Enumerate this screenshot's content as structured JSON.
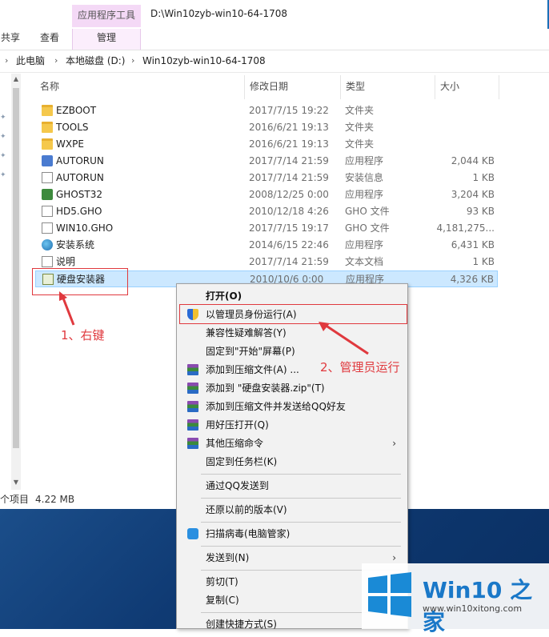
{
  "window": {
    "title": "D:\\Win10zyb-win10-64-1708",
    "context_tab_header": "应用程序工具"
  },
  "ribbon": {
    "tabs": [
      {
        "label": "共享"
      },
      {
        "label": "查看"
      },
      {
        "label": "管理"
      }
    ]
  },
  "address": {
    "crumbs": [
      "此电脑",
      "本地磁盘 (D:)",
      "Win10zyb-win10-64-1708"
    ]
  },
  "columns": {
    "name": "名称",
    "date": "修改日期",
    "type": "类型",
    "size": "大小"
  },
  "files": [
    {
      "name": "EZBOOT",
      "date": "2017/7/15 19:22",
      "type": "文件夹",
      "size": "",
      "icon": "folder-icon"
    },
    {
      "name": "TOOLS",
      "date": "2016/6/21 19:13",
      "type": "文件夹",
      "size": "",
      "icon": "folder-icon"
    },
    {
      "name": "WXPE",
      "date": "2016/6/21 19:13",
      "type": "文件夹",
      "size": "",
      "icon": "folder-icon"
    },
    {
      "name": "AUTORUN",
      "date": "2017/7/14 21:59",
      "type": "应用程序",
      "size": "2,044 KB",
      "icon": "app-icon"
    },
    {
      "name": "AUTORUN",
      "date": "2017/7/14 21:59",
      "type": "安装信息",
      "size": "1 KB",
      "icon": "setup-info-icon"
    },
    {
      "name": "GHOST32",
      "date": "2008/12/25 0:00",
      "type": "应用程序",
      "size": "3,204 KB",
      "icon": "ghost-icon"
    },
    {
      "name": "HD5.GHO",
      "date": "2010/12/18 4:26",
      "type": "GHO 文件",
      "size": "93 KB",
      "icon": "file-icon"
    },
    {
      "name": "WIN10.GHO",
      "date": "2017/7/15 19:17",
      "type": "GHO 文件",
      "size": "4,181,275...",
      "icon": "file-icon"
    },
    {
      "name": "安装系统",
      "date": "2014/6/15 22:46",
      "type": "应用程序",
      "size": "6,431 KB",
      "icon": "installer-icon"
    },
    {
      "name": "说明",
      "date": "2017/7/14 21:59",
      "type": "文本文档",
      "size": "1 KB",
      "icon": "text-file-icon"
    },
    {
      "name": "硬盘安装器",
      "date": "2010/10/6 0:00",
      "type": "应用程序",
      "size": "4,326 KB",
      "icon": "disk-installer-icon",
      "selected": true
    }
  ],
  "status": {
    "count": "个项目",
    "selection_size": "4.22 MB"
  },
  "context_menu": {
    "items": [
      {
        "label": "打开(O)",
        "bold": true
      },
      {
        "label": "以管理员身份运行(A)",
        "icon": "uac-shield-icon"
      },
      {
        "label": "兼容性疑难解答(Y)"
      },
      {
        "label": "固定到\"开始\"屏幕(P)"
      },
      {
        "label": "添加到压缩文件(A) ...",
        "icon": "winrar-icon"
      },
      {
        "label": "添加到 \"硬盘安装器.zip\"(T)",
        "icon": "winrar-icon"
      },
      {
        "label": "添加到压缩文件并发送给QQ好友",
        "icon": "winrar-icon"
      },
      {
        "label": "用好压打开(Q)",
        "icon": "winrar-icon"
      },
      {
        "label": "其他压缩命令",
        "icon": "winrar-icon",
        "submenu": true
      },
      {
        "label": "固定到任务栏(K)"
      },
      {
        "label": "通过QQ发送到"
      },
      {
        "label": "还原以前的版本(V)"
      },
      {
        "label": "扫描病毒(电脑管家)",
        "icon": "pc-manager-icon"
      },
      {
        "label": "发送到(N)",
        "submenu": true
      },
      {
        "label": "剪切(T)"
      },
      {
        "label": "复制(C)"
      },
      {
        "label": "创建快捷方式(S)"
      }
    ]
  },
  "annotations": {
    "step1": "1、右键",
    "step2": "2、管理员运行"
  },
  "logo": {
    "title": "Win10 之家",
    "url": "www.win10xitong.com"
  },
  "colors": {
    "accent_red": "#e0393e",
    "selection_blue": "#cce8ff",
    "logo_blue": "#1a78c8",
    "context_tab_pink": "#f4d9f6"
  }
}
